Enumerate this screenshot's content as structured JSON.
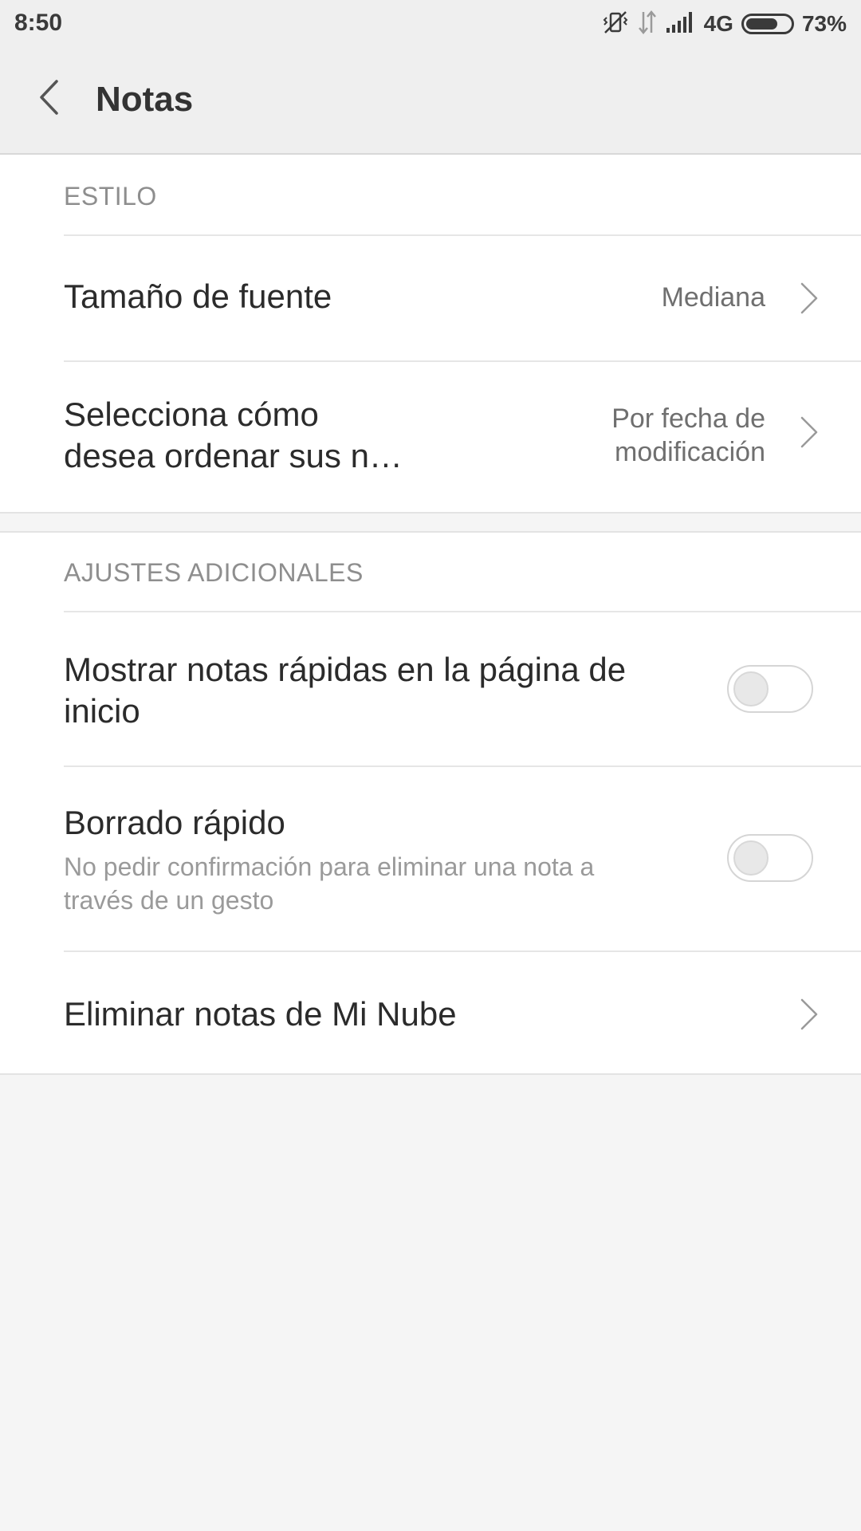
{
  "status_bar": {
    "time": "8:50",
    "network": "4G",
    "battery_percent_label": "73%",
    "battery_level": 0.73,
    "icons": [
      "vibrate-off-icon",
      "data-transfer-icon",
      "signal-icon",
      "battery-icon"
    ]
  },
  "header": {
    "title": "Notas",
    "back_icon": "chevron-left-icon"
  },
  "sections": {
    "style": {
      "header": "ESTILO",
      "font_size": {
        "title": "Tamaño de fuente",
        "value": "Mediana"
      },
      "sort_order": {
        "title_line1": "Selecciona cómo",
        "title_line2": "desea ordenar sus n…",
        "value_line1": "Por fecha de",
        "value_line2": "modificación"
      }
    },
    "additional": {
      "header": "AJUSTES ADICIONALES",
      "quick_notes": {
        "title_line1": "Mostrar notas rápidas en la página de",
        "title_line2": "inicio",
        "enabled": false
      },
      "quick_delete": {
        "title": "Borrado rápido",
        "subtitle_line1": "No pedir confirmación para eliminar una nota a",
        "subtitle_line2": "través de un gesto",
        "enabled": false
      },
      "delete_cloud": {
        "title": "Eliminar notas de Mi Nube"
      }
    }
  },
  "colors": {
    "background": "#f5f5f5",
    "card": "#ffffff",
    "header_bg": "#efefef",
    "primary_text": "#2b2b2b",
    "secondary_text": "#8e8e8e"
  }
}
